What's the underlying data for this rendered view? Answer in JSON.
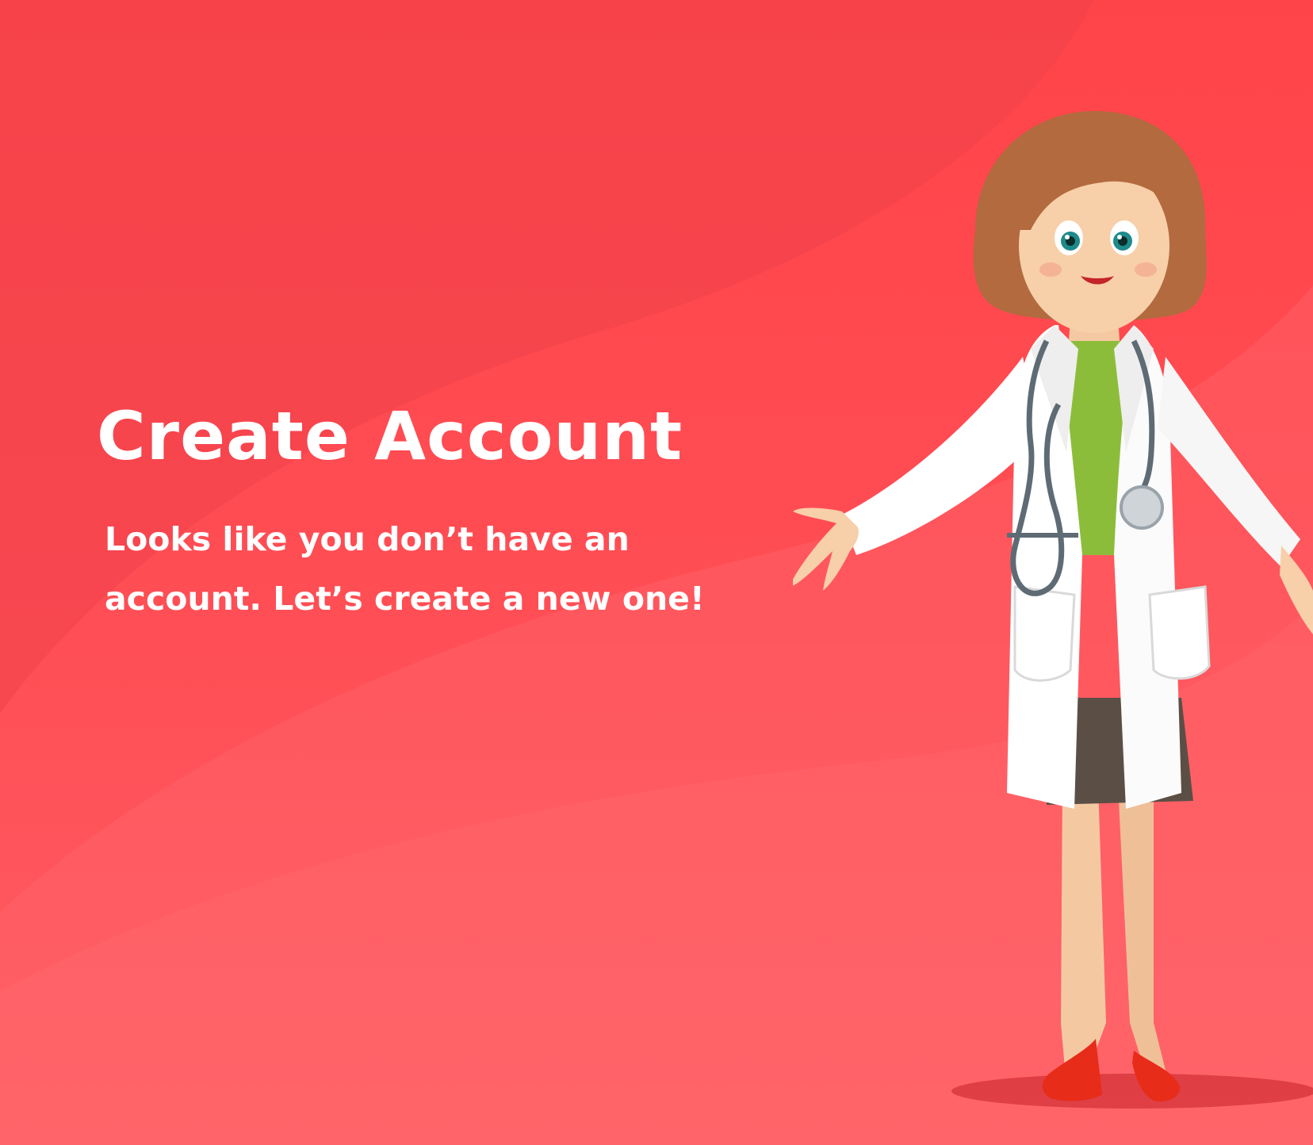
{
  "screen": {
    "background_color": "#ff4a50",
    "wave_color_light": "#ff6167",
    "wave_color_dark": "#f0404a"
  },
  "onboarding": {
    "title": "Create Account",
    "subtitle_lines": [
      "Looks like you don’t have an",
      "account. Let’s create a new one!"
    ]
  },
  "illustration": {
    "icon": "doctor-illustration-icon",
    "colors": {
      "hair": "#b26a3e",
      "skin": "#f7cfa8",
      "coat": "#ffffff",
      "shirt": "#8cbd3a",
      "skirt": "#5b4e45",
      "shoes": "#e82c1a",
      "stethoscope": "#5e6b74"
    }
  }
}
